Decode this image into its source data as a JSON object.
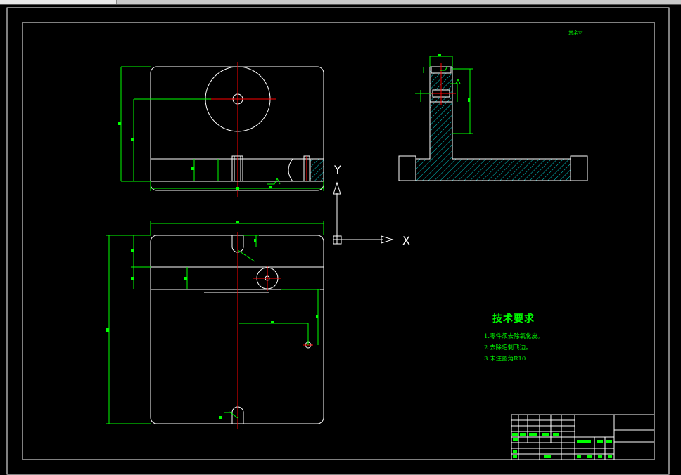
{
  "app": {
    "window_tab": ""
  },
  "colors": {
    "background": "#000000",
    "outline": "#ffffff",
    "dimension": "#00ff00",
    "centerline": "#ff0000",
    "hatch": "#00cccc",
    "ucs": "#ffffff"
  },
  "ucs": {
    "x_label": "X",
    "y_label": "Y"
  },
  "technical_requirements": {
    "title": "技术要求",
    "items": [
      "1.零件须去除氧化皮。",
      "2.去除毛刺飞边。",
      "3.未注圆角R10"
    ]
  },
  "roughness_note": "其余▽",
  "icons": [
    "ucs-icon",
    "roughness-symbol-icon"
  ]
}
